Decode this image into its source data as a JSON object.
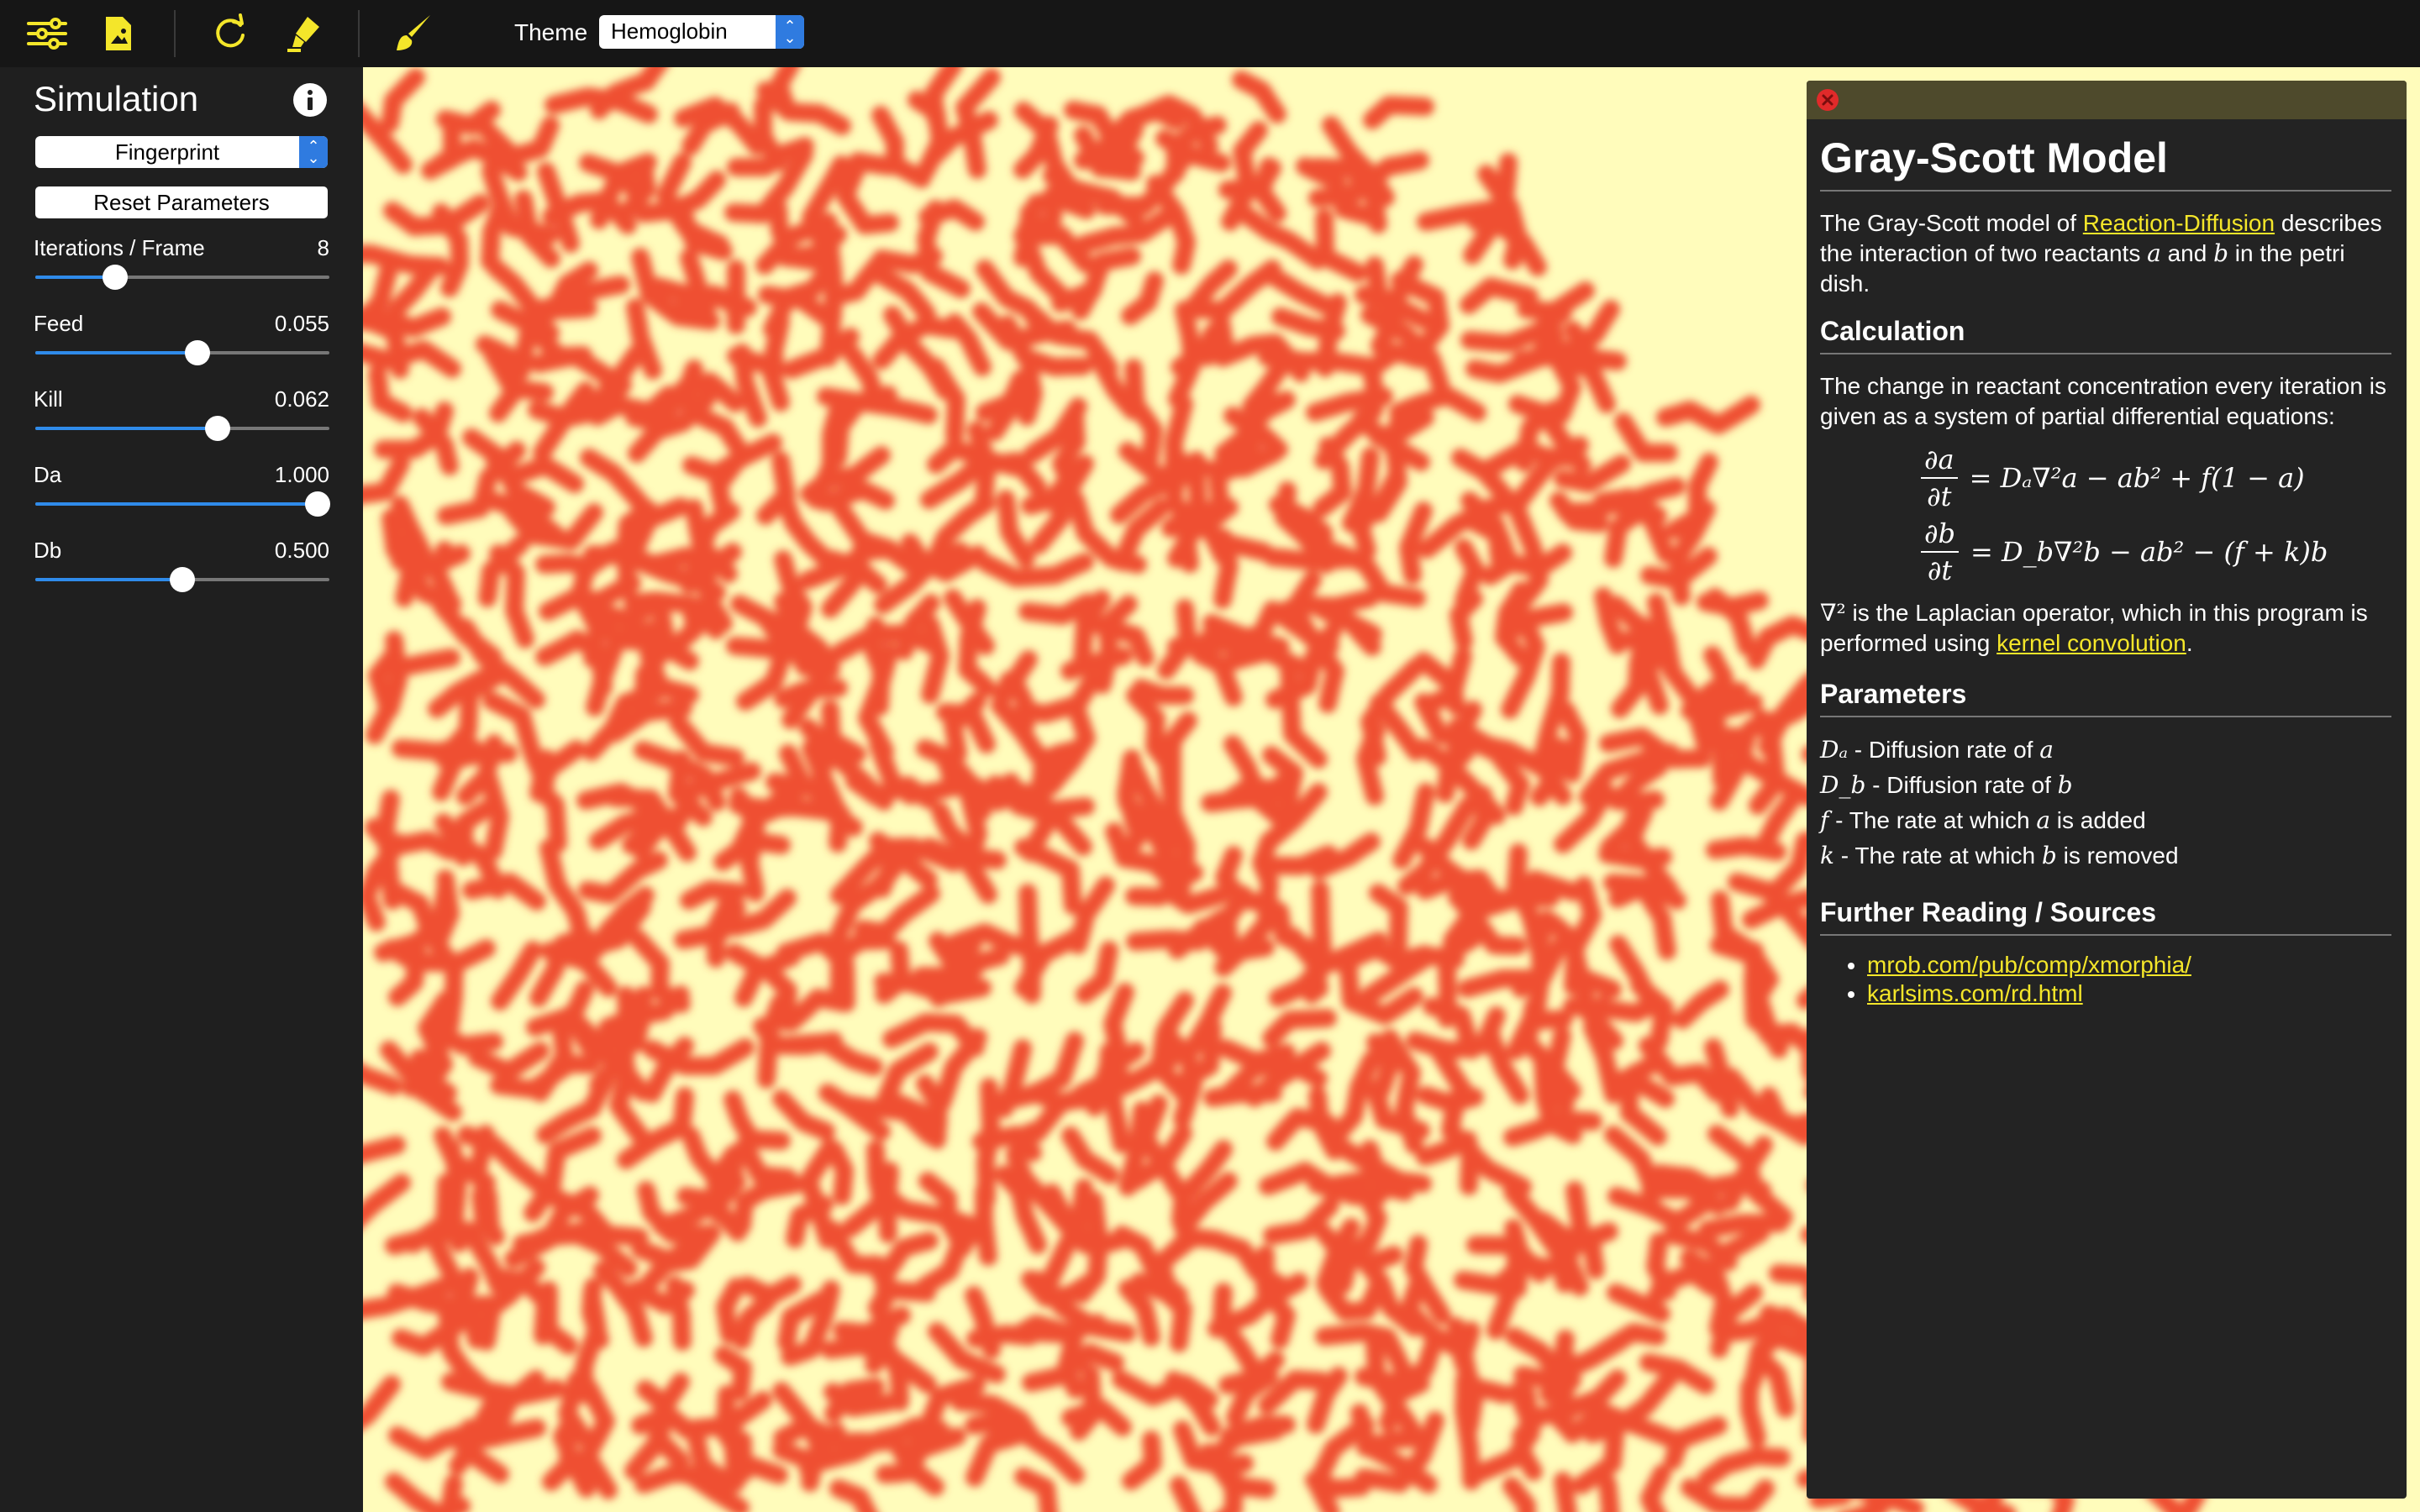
{
  "toolbar": {
    "icons": [
      "settings-sliders-icon",
      "save-image-icon",
      "refresh-icon",
      "highlighter-icon",
      "brush-icon"
    ],
    "theme_label": "Theme",
    "theme_value": "Hemoglobin",
    "accent": "#f4e62a"
  },
  "sidebar": {
    "title": "Simulation",
    "preset": "Fingerprint",
    "reset_label": "Reset Parameters",
    "params": [
      {
        "label": "Iterations / Frame",
        "value": "8",
        "fraction": 0.27
      },
      {
        "label": "Feed",
        "value": "0.055",
        "fraction": 0.55
      },
      {
        "label": "Kill",
        "value": "0.062",
        "fraction": 0.62
      },
      {
        "label": "Da",
        "value": "1.000",
        "fraction": 0.96
      },
      {
        "label": "Db",
        "value": "0.500",
        "fraction": 0.5
      }
    ]
  },
  "canvas": {
    "background": "#fffcbb",
    "pattern_color": "#ef5030"
  },
  "panel": {
    "title": "Gray-Scott Model",
    "intro_1": "The Gray-Scott model of ",
    "intro_link": "Reaction-Diffusion",
    "intro_2": " describes the interaction of two reactants ",
    "intro_a": "a",
    "intro_3": " and ",
    "intro_b": "b",
    "intro_4": " in the petri dish.",
    "calc_heading": "Calculation",
    "calc_text": "The change in reactant concentration every iteration is given as a system of partial differential equations:",
    "eq1_num": "∂a",
    "eq1_den": "∂t",
    "eq1_rhs": "= Dₐ∇²a − ab² + f(1 − a)",
    "eq2_num": "∂b",
    "eq2_den": "∂t",
    "eq2_rhs": "= D_b∇²b − ab² − (f + k)b",
    "laplace_sym": "∇²",
    "laplace_text": " is the Laplacian operator, which in this program is performed using ",
    "laplace_link": "kernel convolution",
    "laplace_end": ".",
    "params_heading": "Parameters",
    "param_items": [
      {
        "sym": "Dₐ",
        "text": " - Diffusion rate of ",
        "var": "a",
        "end": ""
      },
      {
        "sym": "D_b",
        "text": " - Diffusion rate of ",
        "var": "b",
        "end": ""
      },
      {
        "sym": "f",
        "text": " - The rate at which ",
        "var": "a",
        "end": " is added"
      },
      {
        "sym": "k",
        "text": " - The rate at which ",
        "var": "b",
        "end": " is removed"
      }
    ],
    "sources_heading": "Further Reading / Sources",
    "sources": [
      "mrob.com/pub/comp/xmorphia/",
      "karlsims.com/rd.html"
    ]
  }
}
